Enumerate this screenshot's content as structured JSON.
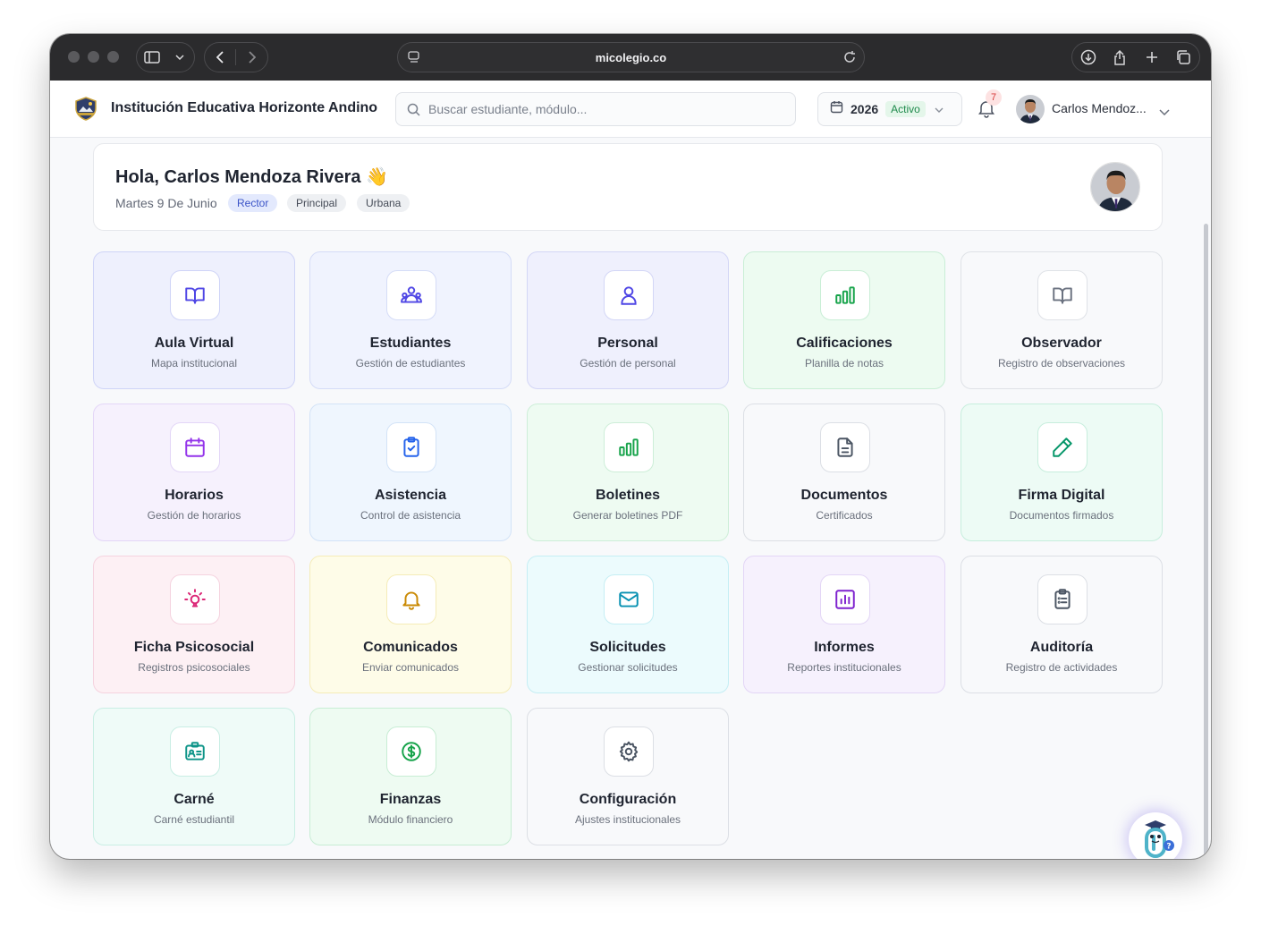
{
  "browser": {
    "url": "micolegio.co"
  },
  "header": {
    "institution": "Institución Educativa Horizonte Andino",
    "search_placeholder": "Buscar estudiante, módulo...",
    "year": "2026",
    "year_status": "Activo",
    "notifications": "7",
    "user_name": "Carlos Mendoz..."
  },
  "greeting": {
    "title": "Hola, Carlos Mendoza Rivera 👋",
    "date": "Martes 9 De Junio",
    "chips": [
      "Rector",
      "Principal",
      "Urbana"
    ]
  },
  "modules": [
    {
      "title": "Aula Virtual",
      "subtitle": "Mapa institucional",
      "icon": "book-open-icon",
      "color": "#4f46e5"
    },
    {
      "title": "Estudiantes",
      "subtitle": "Gestión de estudiantes",
      "icon": "users-icon",
      "color": "#4f46e5"
    },
    {
      "title": "Personal",
      "subtitle": "Gestión de personal",
      "icon": "user-icon",
      "color": "#4f46e5"
    },
    {
      "title": "Calificaciones",
      "subtitle": "Planilla de notas",
      "icon": "bar-chart-icon",
      "color": "#16a34a"
    },
    {
      "title": "Observador",
      "subtitle": "Registro de observaciones",
      "icon": "book-open-icon",
      "color": "#6b7280"
    },
    {
      "title": "Horarios",
      "subtitle": "Gestión de horarios",
      "icon": "calendar-icon",
      "color": "#9333ea"
    },
    {
      "title": "Asistencia",
      "subtitle": "Control de asistencia",
      "icon": "clipboard-check-icon",
      "color": "#2563eb"
    },
    {
      "title": "Boletines",
      "subtitle": "Generar boletines PDF",
      "icon": "bar-chart-icon",
      "color": "#16a34a"
    },
    {
      "title": "Documentos",
      "subtitle": "Certificados",
      "icon": "file-text-icon",
      "color": "#4b5563"
    },
    {
      "title": "Firma Digital",
      "subtitle": "Documentos firmados",
      "icon": "pen-icon",
      "color": "#059669"
    },
    {
      "title": "Ficha Psicosocial",
      "subtitle": "Registros psicosociales",
      "icon": "lightbulb-icon",
      "color": "#db2777"
    },
    {
      "title": "Comunicados",
      "subtitle": "Enviar comunicados",
      "icon": "bell-icon",
      "color": "#ca8a04"
    },
    {
      "title": "Solicitudes",
      "subtitle": "Gestionar solicitudes",
      "icon": "mail-icon",
      "color": "#0891b2"
    },
    {
      "title": "Informes",
      "subtitle": "Reportes institucionales",
      "icon": "report-chart-icon",
      "color": "#7e22ce"
    },
    {
      "title": "Auditoría",
      "subtitle": "Registro de actividades",
      "icon": "clipboard-list-icon",
      "color": "#4b5563"
    },
    {
      "title": "Carné",
      "subtitle": "Carné estudiantil",
      "icon": "id-card-icon",
      "color": "#0d9488"
    },
    {
      "title": "Finanzas",
      "subtitle": "Módulo financiero",
      "icon": "dollar-icon",
      "color": "#16a34a"
    },
    {
      "title": "Configuración",
      "subtitle": "Ajustes institucionales",
      "icon": "gear-icon",
      "color": "#4b5563"
    }
  ]
}
